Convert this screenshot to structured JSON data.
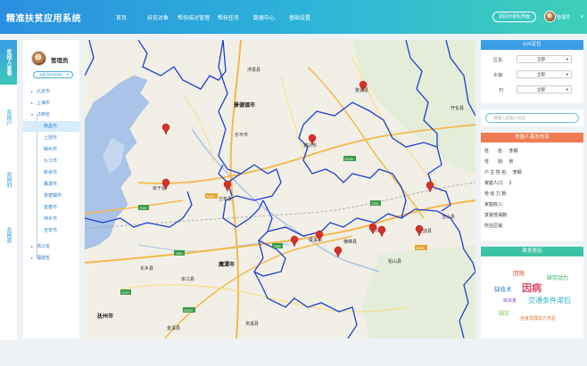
{
  "header": {
    "title": "精准扶贫应用系统",
    "nav": [
      "首页",
      "扶贫对象",
      "帮扶结对管理",
      "帮扶任务",
      "数据中心",
      "基础设置"
    ],
    "visual_button": "返回可视化界面",
    "user": "管理员",
    "caret": "▾"
  },
  "vtabs": [
    "贫困人查看",
    "贫困户",
    "贫困村",
    "贫困县"
  ],
  "tree": {
    "admin_title": "管理员",
    "role": "administrator",
    "caret": "▾",
    "items": [
      {
        "label": "北京市",
        "arrow": "▸"
      },
      {
        "label": "上海市",
        "arrow": "▸"
      },
      {
        "label": "江西省",
        "arrow": "▾"
      },
      {
        "label": "南昌市"
      },
      {
        "label": "上饶市"
      },
      {
        "label": "赣州市"
      },
      {
        "label": "九江市"
      },
      {
        "label": "新余市"
      },
      {
        "label": "鹰潭市"
      },
      {
        "label": "景德镇市"
      },
      {
        "label": "宜春市"
      },
      {
        "label": "萍乡市"
      },
      {
        "label": "吉安市"
      },
      {
        "label": "浙江省",
        "arrow": "▸"
      },
      {
        "label": "福建省",
        "arrow": "▸"
      }
    ]
  },
  "map": {
    "cities": [
      {
        "name": "景德镇市",
        "bold": true
      },
      {
        "name": "德兴市"
      },
      {
        "name": "乐平市"
      },
      {
        "name": "万年县"
      },
      {
        "name": "余干县"
      },
      {
        "name": "鹰潭市",
        "bold": true
      },
      {
        "name": "贵溪市"
      },
      {
        "name": "弋阳县"
      },
      {
        "name": "上饶县"
      },
      {
        "name": "东乡县"
      },
      {
        "name": "余江县"
      },
      {
        "name": "抚州市",
        "bold": true
      },
      {
        "name": "金溪县"
      },
      {
        "name": "资溪县"
      },
      {
        "name": "婺源县"
      },
      {
        "name": "开化县"
      },
      {
        "name": "浮梁县"
      },
      {
        "name": "横峰县"
      },
      {
        "name": "铅山县"
      },
      {
        "name": "玉山县"
      }
    ],
    "road_labels": [
      "G60",
      "G56",
      "S201",
      "S20",
      "G206",
      "S31",
      "S201",
      "G70",
      "G320"
    ]
  },
  "gis": {
    "title": "GIS定位",
    "rows": [
      {
        "label": "区县:",
        "value": "全部"
      },
      {
        "label": "乡镇:",
        "value": "全部"
      },
      {
        "label": "村:",
        "value": "全部"
      }
    ],
    "caret": "▾"
  },
  "search": {
    "placeholder": "请输入贫困人姓名"
  },
  "info": {
    "title": "贫困人基本信息",
    "rows": [
      {
        "label": "姓　　名:",
        "value": "李钢"
      },
      {
        "label": "性　　别:",
        "value": "男"
      },
      {
        "label": "户 主 姓 名:",
        "value": "李钢"
      },
      {
        "label": "家庭人口:",
        "value": "3"
      },
      {
        "label": "劳 动 力 数:",
        "value": ""
      },
      {
        "label": "家庭收入:",
        "value": ""
      },
      {
        "label": "享受低保数:",
        "value": ""
      },
      {
        "label": "所在区域:",
        "value": ""
      }
    ]
  },
  "cause": {
    "title": "致贫原因",
    "words": [
      {
        "text": "因残",
        "color": "#e0532a"
      },
      {
        "text": "缺劳动力",
        "color": "#2fae5a"
      },
      {
        "text": "缺技术",
        "color": "#2a7fd4"
      },
      {
        "text": "因病",
        "color": "#e24a6a"
      },
      {
        "text": "缺资金",
        "color": "#8a4fc4"
      },
      {
        "text": "交通条件滞后",
        "color": "#2cb2c8"
      },
      {
        "text": "因灾",
        "color": "#6ab83a"
      },
      {
        "text": "自身发展动力不足",
        "color": "#e0742a"
      }
    ]
  },
  "colors": {
    "header_start": "#2b8fe0",
    "header_end": "#3fd0b8",
    "gis": "#3a9ee6",
    "info": "#f07b52",
    "cause": "#3cc3a5"
  }
}
